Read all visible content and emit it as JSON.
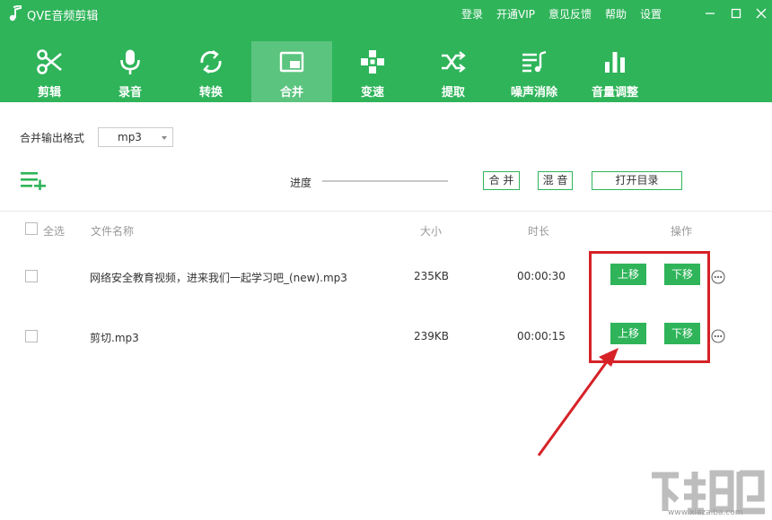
{
  "app": {
    "title": "QVE音频剪辑",
    "links": [
      "登录",
      "开通VIP",
      "意见反馈",
      "帮助",
      "设置"
    ]
  },
  "toolbar": {
    "items": [
      {
        "label": "剪辑",
        "icon": "scissors-icon",
        "active": false
      },
      {
        "label": "录音",
        "icon": "microphone-icon",
        "active": false
      },
      {
        "label": "转换",
        "icon": "convert-icon",
        "active": false
      },
      {
        "label": "合并",
        "icon": "merge-icon",
        "active": true
      },
      {
        "label": "变速",
        "icon": "speed-icon",
        "active": false
      },
      {
        "label": "提取",
        "icon": "extract-icon",
        "active": false
      },
      {
        "label": "噪声消除",
        "icon": "noise-icon",
        "active": false
      },
      {
        "label": "音量调整",
        "icon": "volume-icon",
        "active": false
      }
    ]
  },
  "merge": {
    "format_label": "合并输出格式",
    "format_value": "mp3",
    "progress_label": "进度",
    "progress": 0,
    "merge_btn": "合 并",
    "mix_btn": "混 音",
    "open_dir_btn": "打开目录"
  },
  "table": {
    "headers": {
      "select_all": "全选",
      "name": "文件名称",
      "size": "大小",
      "duration": "时长",
      "action": "操作"
    },
    "rows": [
      {
        "name": "网络安全教育视频，进来我们一起学习吧_(new).mp3",
        "size": "235KB",
        "duration": "00:00:30",
        "up": "上移",
        "down": "下移"
      },
      {
        "name": "剪切.mp3",
        "size": "239KB",
        "duration": "00:00:15",
        "up": "上移",
        "down": "下移"
      }
    ]
  },
  "watermark": {
    "site": "www.xiazaiba.com"
  },
  "colors": {
    "brand": "#2fb45a",
    "highlight": "#d62227"
  }
}
